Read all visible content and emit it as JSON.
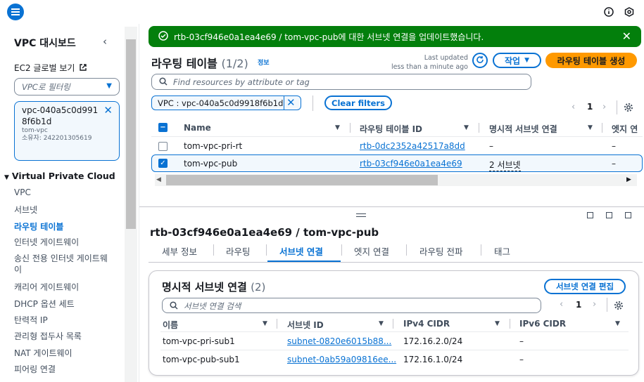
{
  "sidebar": {
    "title": "VPC 대시보드",
    "ec2_global_view": "EC2 글로벌 보기",
    "filter_placeholder": "VPC로 필터링",
    "selected_vpc": {
      "id": "vpc-040a5c0d9918f6b1d",
      "name": "tom-vpc",
      "owner": "소유자: 242201305619"
    },
    "section": "Virtual Private Cloud",
    "items": [
      {
        "label": "VPC"
      },
      {
        "label": "서브넷"
      },
      {
        "label": "라우팅 테이블"
      },
      {
        "label": "인터넷 게이트웨이"
      },
      {
        "label": "송신 전용 인터넷 게이트웨이"
      },
      {
        "label": "캐리어 게이트웨이"
      },
      {
        "label": "DHCP 옵션 세트"
      },
      {
        "label": "탄력적 IP"
      },
      {
        "label": "관리형 접두사 목록"
      },
      {
        "label": "NAT 게이트웨이"
      },
      {
        "label": "피어링 연결"
      }
    ]
  },
  "flash": {
    "message": "rtb-03cf946e0a1ea4e69 / tom-vpc-pub에 대한 서브넷 연결을 업데이트했습니다."
  },
  "main": {
    "title": "라우팅 테이블",
    "count": "(1/2)",
    "info": "정보",
    "last_updated_1": "Last updated",
    "last_updated_2": "less than a minute ago",
    "actions": "작업",
    "create": "라우팅 테이블 생성",
    "search_placeholder": "Find resources by attribute or tag",
    "vpc_filter": "VPC : vpc-040a5c0d9918f6b1d",
    "clear_filters": "Clear filters",
    "page": "1",
    "columns": [
      "Name",
      "라우팅 테이블 ID",
      "명시적 서브넷 연결",
      "엣지 연"
    ],
    "rows": [
      {
        "name": "tom-vpc-pri-rt",
        "id": "rtb-0dc2352a42517a8dd",
        "subnets": "–",
        "edge": "–",
        "selected": false
      },
      {
        "name": "tom-vpc-pub",
        "id": "rtb-03cf946e0a1ea4e69",
        "subnets": "2 서브넷",
        "edge": "–",
        "selected": true
      }
    ]
  },
  "detail": {
    "title": "rtb-03cf946e0a1ea4e69 / tom-vpc-pub",
    "tabs": [
      "세부 정보",
      "라우팅",
      "서브넷 연결",
      "엣지 연결",
      "라우팅 전파",
      "태그"
    ],
    "active_tab": 2,
    "card": {
      "title": "명시적 서브넷 연결",
      "count": "(2)",
      "edit": "서브넷 연결 편집",
      "search_placeholder": "서브넷 연결 검색",
      "page": "1",
      "columns": [
        "이름",
        "서브넷 ID",
        "IPv4 CIDR",
        "IPv6 CIDR"
      ],
      "rows": [
        {
          "name": "tom-vpc-pri-sub1",
          "id": "subnet-0820e6015b88...",
          "ipv4": "172.16.2.0/24",
          "ipv6": "–"
        },
        {
          "name": "tom-vpc-pub-sub1",
          "id": "subnet-0ab59a09816ee...",
          "ipv4": "172.16.1.0/24",
          "ipv6": "–"
        }
      ]
    }
  },
  "colors": {
    "accent": "#0972d3",
    "success": "#037f0c",
    "primary": "#ff9900"
  }
}
